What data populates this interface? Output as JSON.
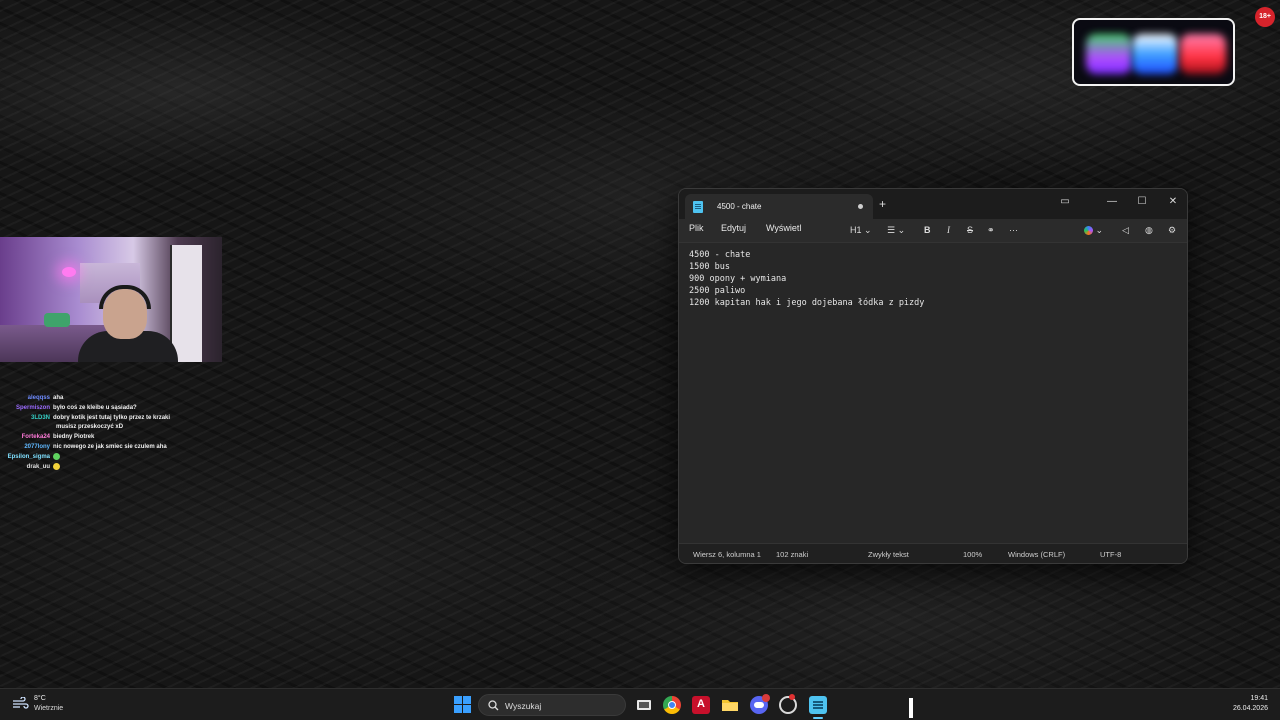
{
  "notepad": {
    "tab_title": "4500 - chate",
    "new_tab": "+",
    "window_controls": {
      "minimize": "—",
      "maximize": "☐",
      "close": "✕"
    },
    "menu": [
      "Plik",
      "Edytuj",
      "Wyświetl"
    ],
    "toolbar": {
      "heading": "H1",
      "bold": "B",
      "italic": "I",
      "strike": "S"
    },
    "lines": [
      "4500 - chate",
      "1500 bus",
      "900 opony + wymiana",
      "2500 paliwo",
      "1200 kapitan hak i jego dojebana łódka z pizdy"
    ],
    "status": {
      "position": "Wiersz 6, kolumna 1",
      "chars": "102 znaki",
      "format": "Zwykły tekst",
      "zoom": "100%",
      "line_ending": "Windows (CRLF)",
      "encoding": "UTF-8"
    }
  },
  "chat": [
    {
      "user": "aleqqss",
      "msg": "aha",
      "color": "#6f8cff"
    },
    {
      "user": "Spermiszon",
      "msg": "było coś ze kleibe u sąsiada?",
      "color": "#9b6bff"
    },
    {
      "user": "3LD3N",
      "msg": "dobry kotik jest tutaj tylko przez te krzaki",
      "color": "#35d0c6",
      "cont": "musisz przeskoczyć xD"
    },
    {
      "user": "Forteka24",
      "msg": "biedny Piotrek",
      "color": "#ff7ad9"
    },
    {
      "user": "2077lony",
      "msg": "nic nowego ze jak smiec sie czulem aha",
      "color": "#5fb8ff"
    },
    {
      "user": "Epsilon_sigma",
      "msg": "",
      "color": "#7fe0ff",
      "emote": "#5fd35f"
    },
    {
      "user": "drak_uu",
      "msg": "",
      "color": "#e0e0e0",
      "emote": "#f2d23a"
    }
  ],
  "badge": "18+",
  "taskbar": {
    "weather_temp": "8°C",
    "weather_desc": "Wietrznie",
    "search_placeholder": "Wyszukaj",
    "time": "19:41",
    "date": "26.04.2026"
  }
}
